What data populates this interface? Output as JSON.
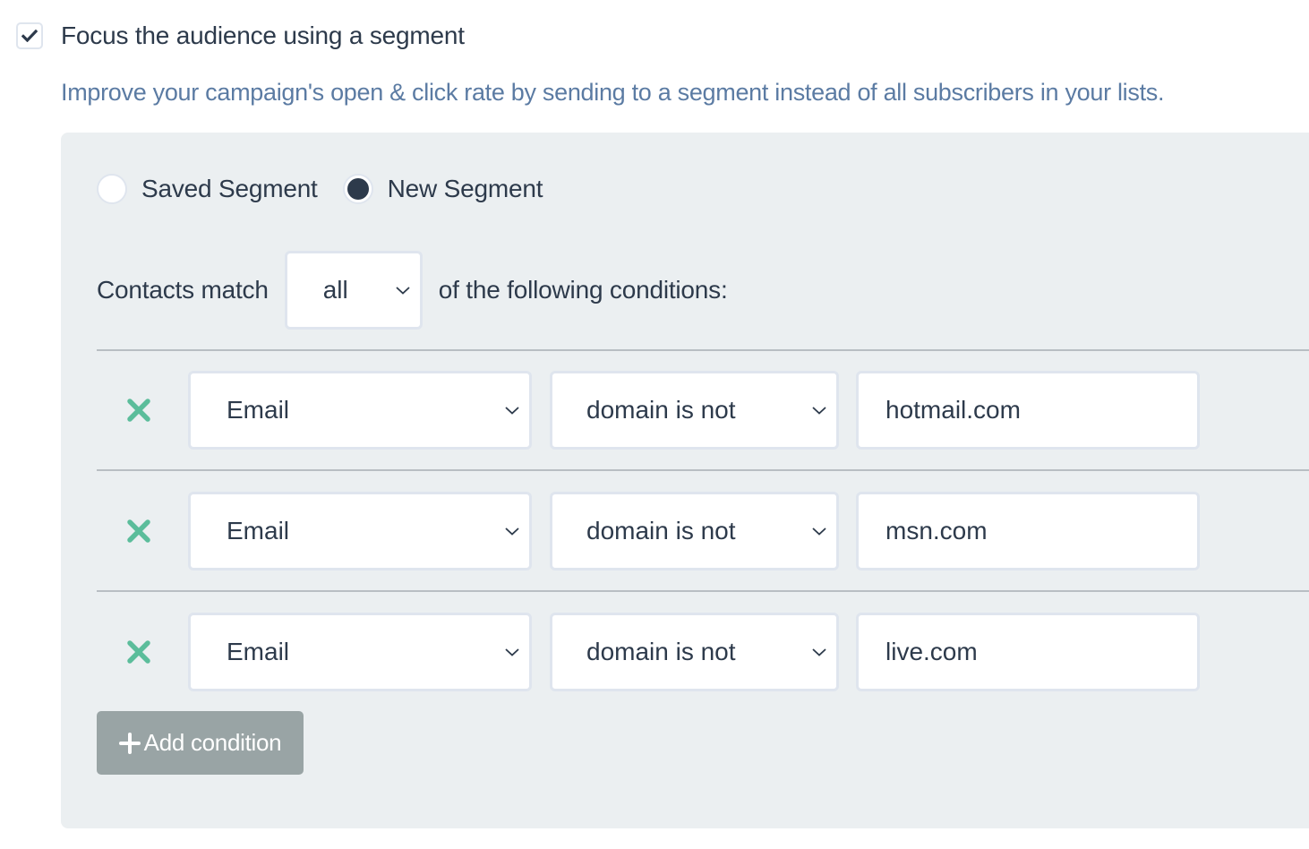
{
  "segment_toggle": {
    "checked": true,
    "label": "Focus the audience using a segment",
    "hint": "Improve your campaign's open & click rate by sending to a segment instead of all subscribers in your lists."
  },
  "segment_type": {
    "options": [
      {
        "label": "Saved Segment",
        "selected": false
      },
      {
        "label": "New Segment",
        "selected": true
      }
    ]
  },
  "match": {
    "prefix": "Contacts match",
    "value": "all",
    "suffix": "of the following conditions:"
  },
  "conditions": [
    {
      "field": "Email",
      "operator": "domain is not",
      "value": "hotmail.com"
    },
    {
      "field": "Email",
      "operator": "domain is not",
      "value": "msn.com"
    },
    {
      "field": "Email",
      "operator": "domain is not",
      "value": "live.com"
    }
  ],
  "add_condition": {
    "icon": "plus-icon",
    "label": "Add condition"
  },
  "colors": {
    "text": "#2d3a4b",
    "hint": "#5b7ba3",
    "panel_bg": "#ebeff1",
    "remove_icon": "#5bbd9b",
    "add_button_bg": "#99a4a5",
    "input_border": "#dfe5ee",
    "divider": "#b8bec3"
  }
}
